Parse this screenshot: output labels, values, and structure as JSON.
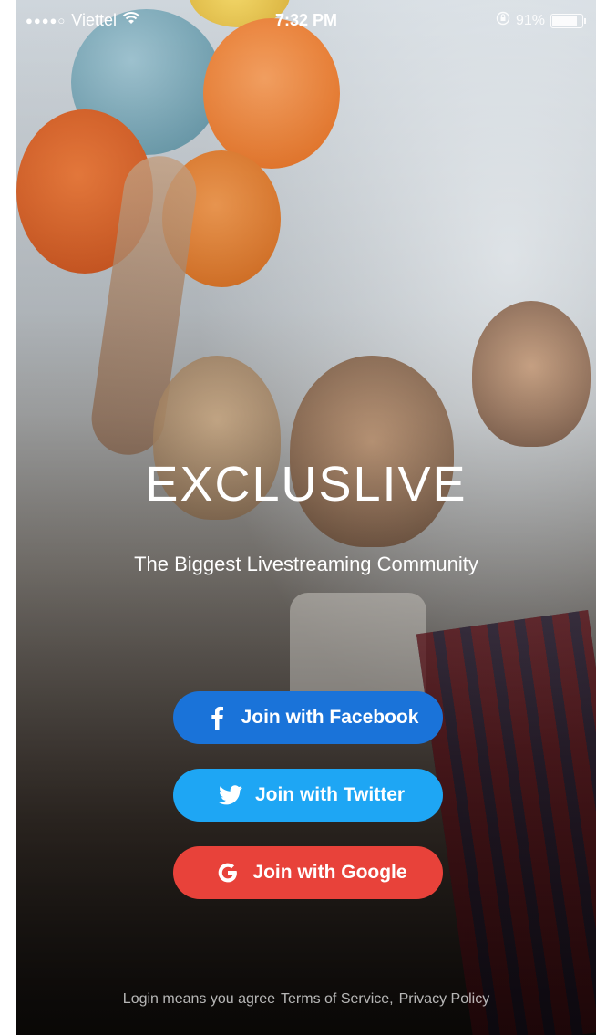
{
  "status_bar": {
    "signal": "●●●●○",
    "carrier": "Viettel",
    "time": "7:32 PM",
    "battery_percent": "91%",
    "battery_level": 0.91
  },
  "brand": {
    "name": "EXCLUSLIVE",
    "tagline": "The Biggest Livestreaming Community"
  },
  "buttons": [
    {
      "label": "Join with Facebook",
      "color": "#1a73d9",
      "icon": "facebook-icon"
    },
    {
      "label": "Join with Twitter",
      "color": "#1ea6f4",
      "icon": "twitter-icon"
    },
    {
      "label": "Join with Google",
      "color": "#e8423a",
      "icon": "google-icon"
    }
  ],
  "footer": {
    "prefix": "Login means you agree",
    "terms": "Terms of Service,",
    "privacy": "Privacy Policy"
  }
}
